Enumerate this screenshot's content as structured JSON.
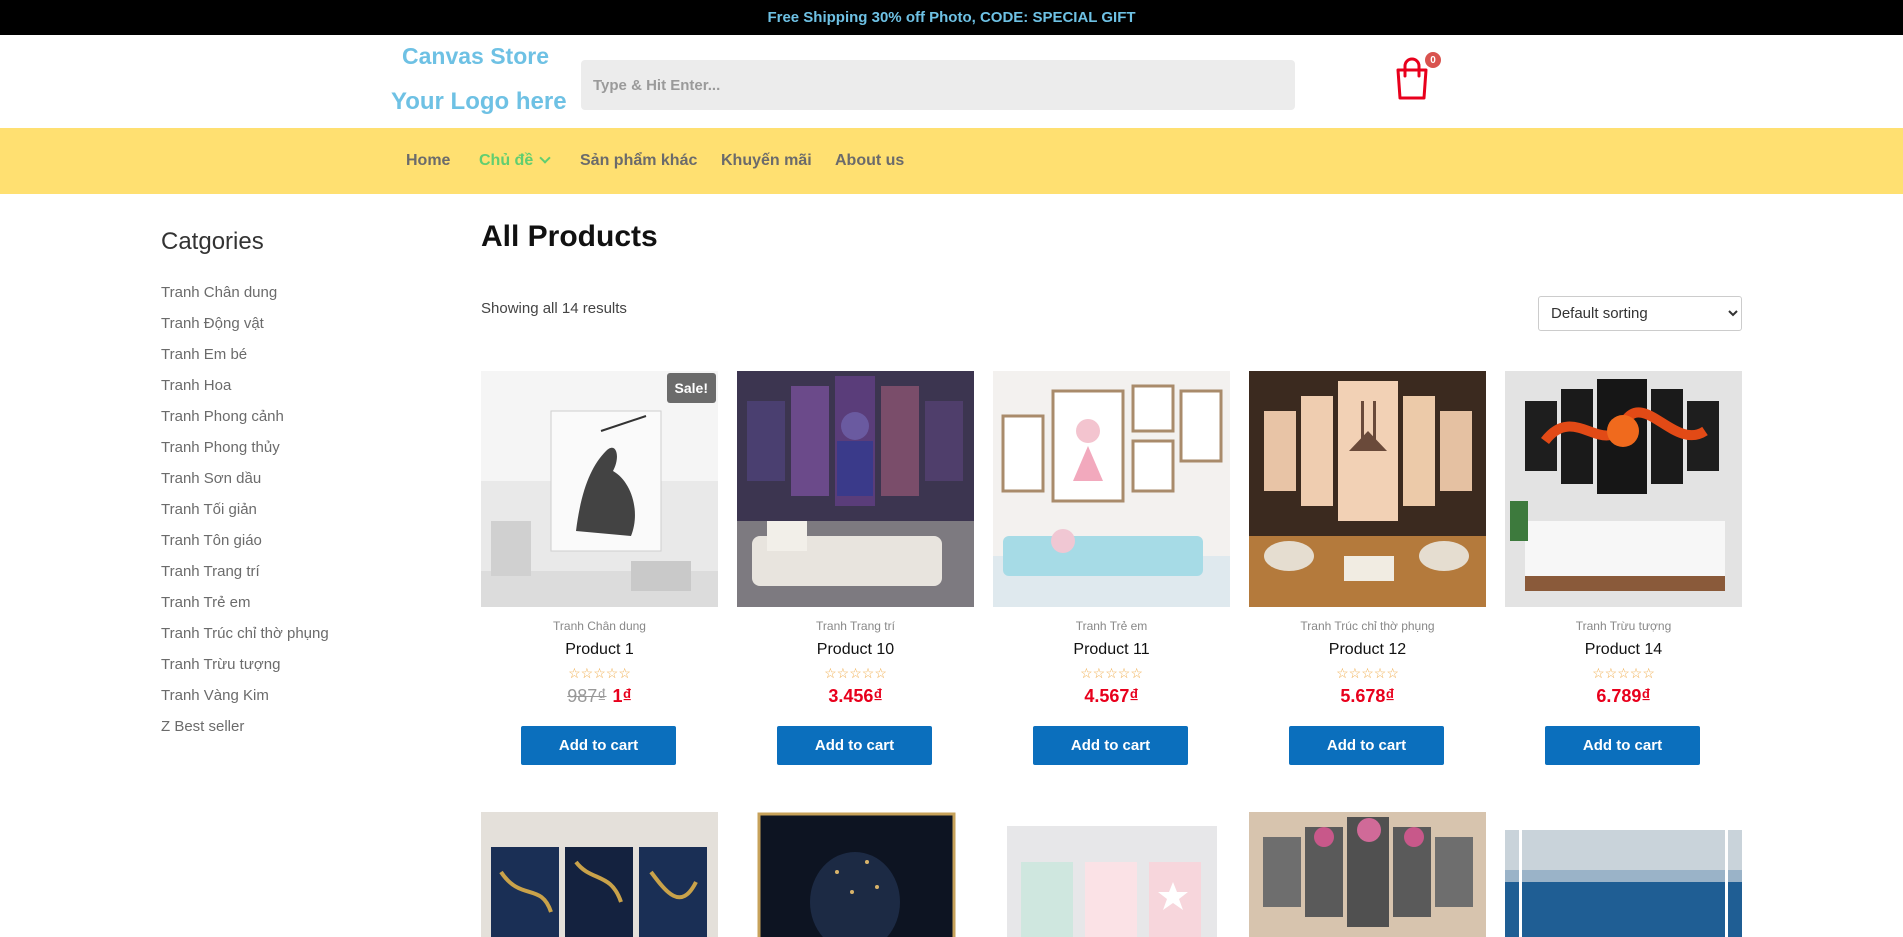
{
  "promo": "Free Shipping 30% off Photo, CODE: SPECIAL GIFT",
  "header": {
    "logo_line1": "Canvas Store",
    "logo_line2": "Your Logo here",
    "search_placeholder": "Type & Hit Enter...",
    "cart_count": "0"
  },
  "nav": {
    "items": [
      "Home",
      "Chủ đề",
      "Sản phẩm khác",
      "Khuyến mãi",
      "About us"
    ]
  },
  "sidebar": {
    "title": "Catgories",
    "categories": [
      "Tranh Chân dung",
      "Tranh Động vật",
      "Tranh Em bé",
      "Tranh Hoa",
      "Tranh Phong cảnh",
      "Tranh Phong thủy",
      "Tranh Sơn dầu",
      "Tranh Tối giản",
      "Tranh Tôn giáo",
      "Tranh Trang trí",
      "Tranh Trẻ em",
      "Tranh Trúc chỉ thờ phụng",
      "Tranh Trừu tượng",
      "Tranh Vàng Kim",
      "Z Best seller"
    ]
  },
  "main": {
    "title": "All Products",
    "results": "Showing all 14 results",
    "sort_selected": "Default sorting",
    "add_to_cart": "Add to cart",
    "sale_badge": "Sale!",
    "products": [
      {
        "category": "Tranh Chân dung",
        "name": "Product 1",
        "old_price": "987₫",
        "price": "1₫"
      },
      {
        "category": "Tranh Trang trí",
        "name": "Product 10",
        "price": "3.456₫"
      },
      {
        "category": "Tranh Trẻ em",
        "name": "Product 11",
        "price": "4.567₫"
      },
      {
        "category": "Tranh Trúc chỉ thờ phụng",
        "name": "Product 12",
        "price": "5.678₫"
      },
      {
        "category": "Tranh Trừu tượng",
        "name": "Product 14",
        "price": "6.789₫"
      }
    ]
  },
  "colors": {
    "accent": "#6ec1e4",
    "nav_bg": "#ffe071",
    "button": "#0b6fbd",
    "price": "#e8001c"
  }
}
